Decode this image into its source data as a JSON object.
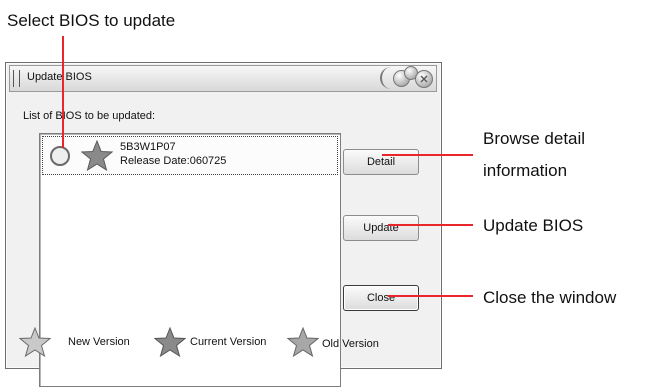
{
  "callouts": {
    "select_bios": "Select BIOS to update",
    "browse_detail_line1": "Browse detail",
    "browse_detail_line2": "information",
    "update_bios": "Update BIOS",
    "close_window": "Close the window"
  },
  "window": {
    "title": "Update BIOS",
    "list_label": "List of BIOS to be updated:",
    "items": [
      {
        "name": "5B3W1P07",
        "release_date": "Release Date:060725",
        "icon": "star-icon"
      }
    ],
    "buttons": {
      "detail": "Detail",
      "update": "Update",
      "close": "Close"
    },
    "legend": [
      {
        "label": "New Version",
        "icon": "star-icon",
        "color": "#c9c9c9"
      },
      {
        "label": "Current Version",
        "icon": "star-icon",
        "color": "#8a8a8a"
      },
      {
        "label": "Old Version",
        "icon": "star-icon",
        "color": "#a7a7a7"
      }
    ]
  },
  "colors": {
    "callout_line": "#e8262b"
  }
}
